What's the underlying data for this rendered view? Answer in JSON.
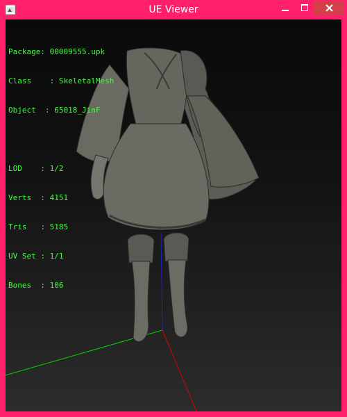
{
  "window": {
    "title": "UE Viewer",
    "accent_color": "#ff1f6a",
    "close_hover_color": "#d3404a"
  },
  "info": {
    "package": {
      "label": "Package",
      "value": "00009555.upk"
    },
    "class": {
      "label": "Class  ",
      "value": "SkeletalMesh"
    },
    "object": {
      "label": "Object ",
      "value": "65018_JinF"
    },
    "lod": {
      "label": "LOD    ",
      "value": "1/2"
    },
    "verts": {
      "label": "Verts  ",
      "value": "4151"
    },
    "tris": {
      "label": "Tris   ",
      "value": "5185"
    },
    "uvset": {
      "label": "UV Set ",
      "value": "1/1"
    },
    "bones": {
      "label": "Bones  ",
      "value": "106"
    },
    "text_color": "#3cff3c"
  },
  "scene": {
    "axis_x_color": "#00d800",
    "axis_y_color": "#d80000",
    "axis_z_color": "#2020c0",
    "mesh_color": "#6f6f68"
  }
}
